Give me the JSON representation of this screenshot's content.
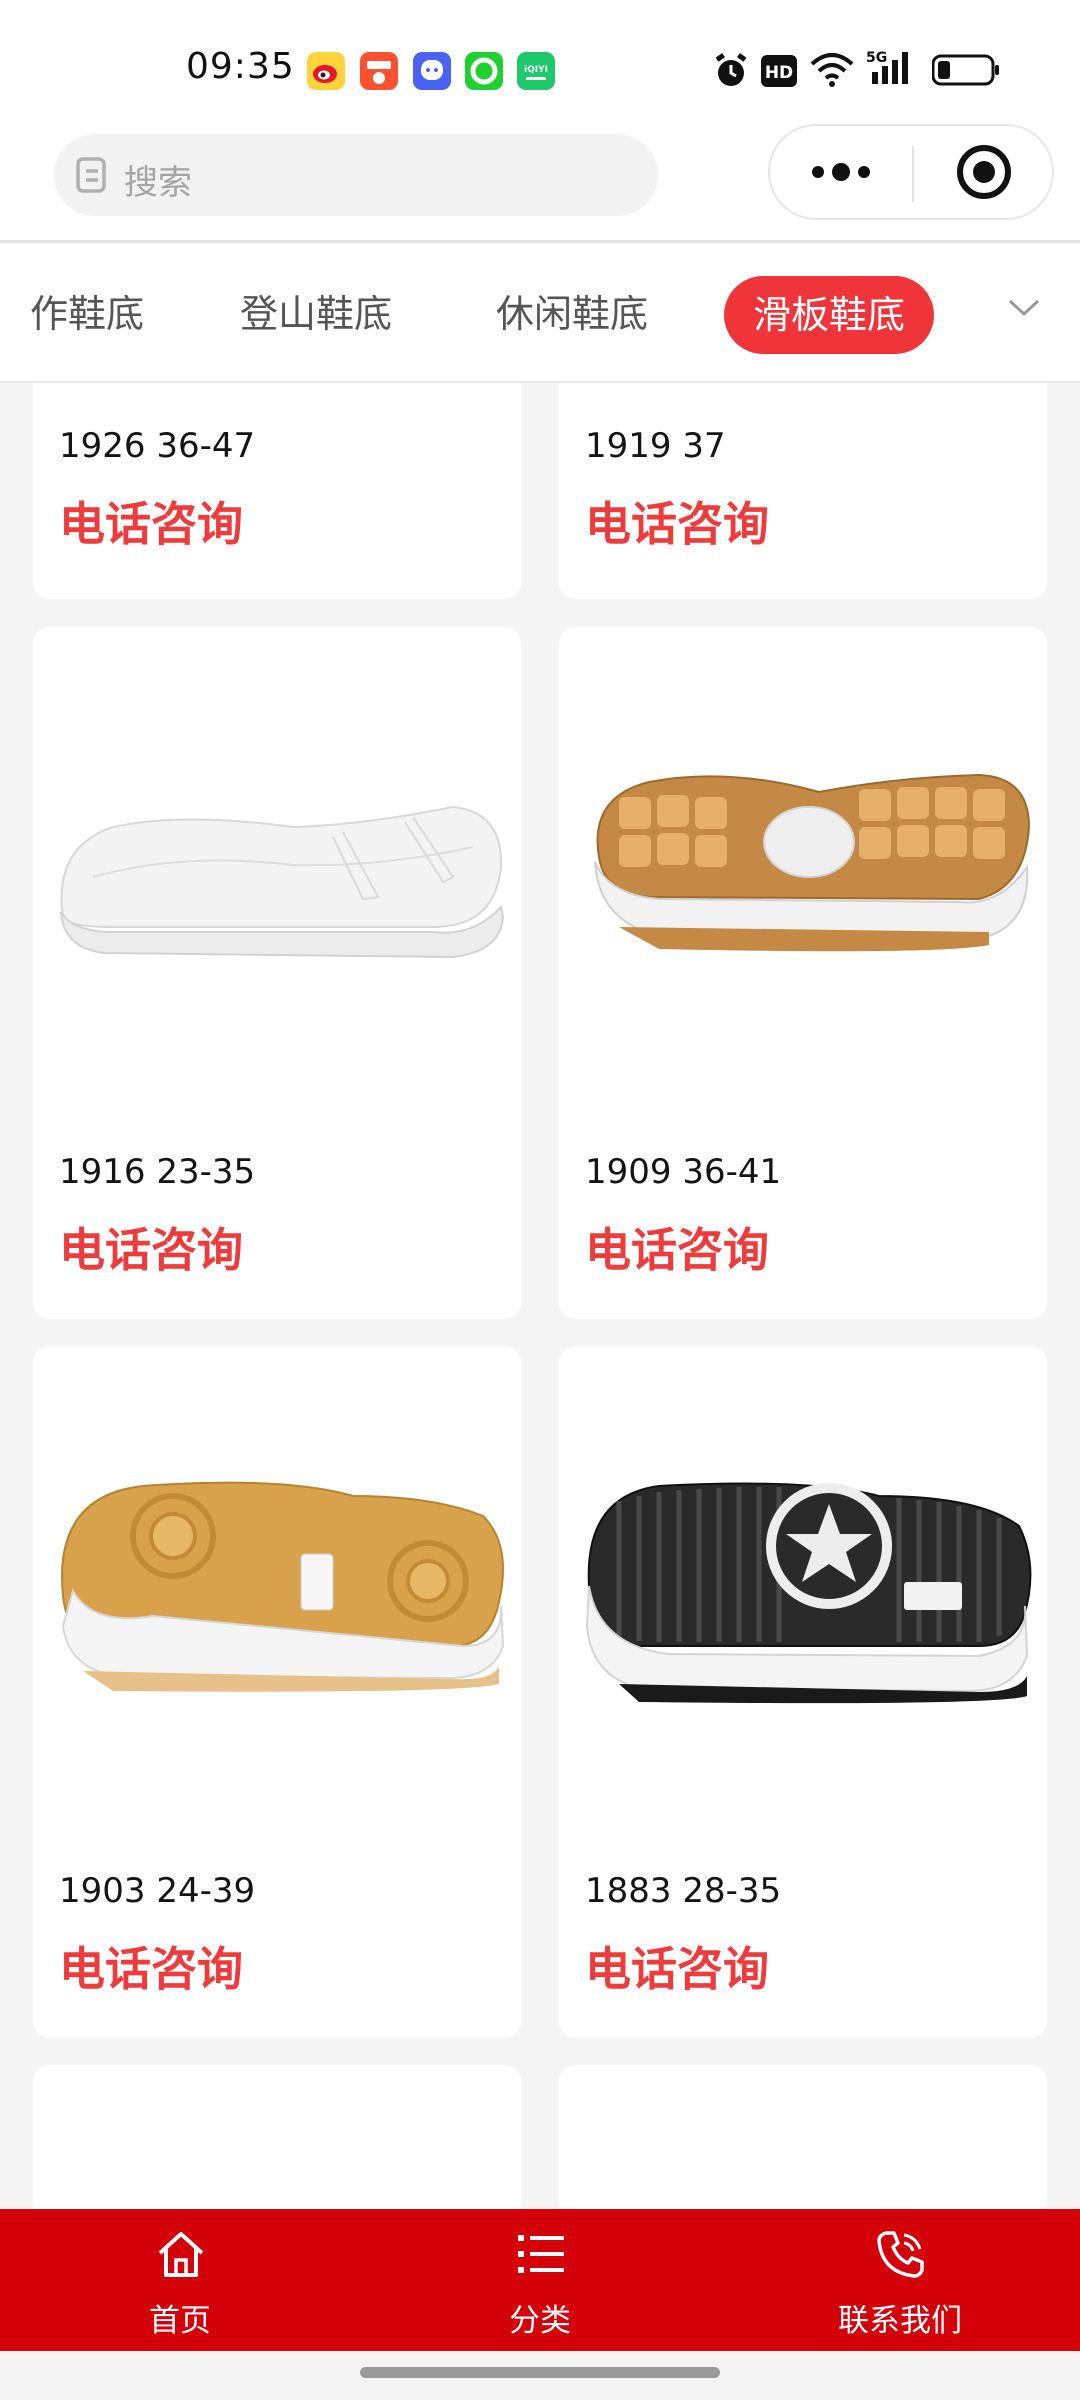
{
  "status_bar": {
    "time": "09:35",
    "notification_icons": [
      "weibo-icon",
      "taobao-icon",
      "qq-icon",
      "wechat-icon",
      "iqiyi-icon"
    ],
    "system_icons": [
      "alarm-icon",
      "hd-icon",
      "wifi-icon",
      "5g-signal-icon",
      "battery-icon"
    ],
    "hd_label": "HD",
    "network_label": "5G",
    "iqiyi_label": "iQIYI"
  },
  "header": {
    "search_placeholder": "搜索",
    "capsule_icons": [
      "more-icon",
      "target-icon"
    ]
  },
  "tabs": {
    "items": [
      "作鞋底",
      "登山鞋底",
      "休闲鞋底",
      "滑板鞋底"
    ],
    "active_index": 3
  },
  "products": [
    {
      "name": "1926 36-47",
      "price": "电话咨询",
      "image": "sole-partial"
    },
    {
      "name": "1919 37",
      "price": "电话咨询",
      "image": "sole-partial"
    },
    {
      "name": "1916 23-35",
      "price": "电话咨询",
      "image": "white-sole-icon"
    },
    {
      "name": "1909 36-41",
      "price": "电话咨询",
      "image": "brown-chunky-sole-icon"
    },
    {
      "name": "1903 24-39",
      "price": "电话咨询",
      "image": "gum-circle-sole-icon"
    },
    {
      "name": "1883 28-35",
      "price": "电话咨询",
      "image": "black-star-sole-icon"
    }
  ],
  "tabbar": {
    "items": [
      {
        "label": "首页",
        "icon": "home-icon"
      },
      {
        "label": "分类",
        "icon": "list-icon"
      },
      {
        "label": "联系我们",
        "icon": "phone-icon"
      }
    ]
  },
  "colors": {
    "accent": "#f0353a",
    "tabbar": "#d4000a",
    "price": "#ef3b3b"
  }
}
